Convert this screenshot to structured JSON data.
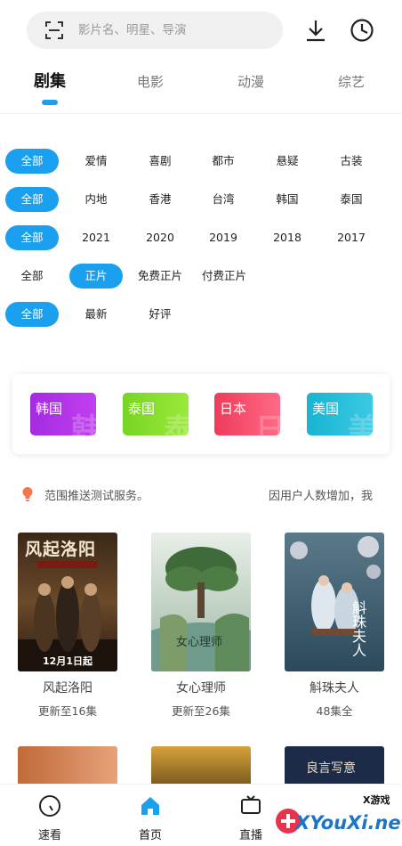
{
  "search": {
    "placeholder": "影片名、明星、导演"
  },
  "icons": {
    "scan": "scan-icon",
    "download": "download-icon",
    "history": "clock-icon",
    "bulb": "lightbulb-icon"
  },
  "tabs": [
    {
      "label": "剧集",
      "active": true
    },
    {
      "label": "电影",
      "active": false
    },
    {
      "label": "动漫",
      "active": false
    },
    {
      "label": "综艺",
      "active": false
    }
  ],
  "filters": {
    "genre": [
      "全部",
      "爱情",
      "喜剧",
      "都市",
      "悬疑",
      "古装"
    ],
    "region": [
      "全部",
      "内地",
      "香港",
      "台湾",
      "韩国",
      "泰国"
    ],
    "year": [
      "全部",
      "2021",
      "2020",
      "2019",
      "2018",
      "2017"
    ],
    "pay": [
      "全部",
      "正片",
      "免费正片",
      "付费正片"
    ],
    "sort": [
      "全部",
      "最新",
      "好评"
    ]
  },
  "regions": [
    {
      "label": "韩国",
      "mark": "韩",
      "color_from": "#a32be0",
      "color_to": "#c23ff1"
    },
    {
      "label": "泰国",
      "mark": "泰",
      "color_from": "#77d523",
      "color_to": "#9be93b"
    },
    {
      "label": "日本",
      "mark": "日",
      "color_from": "#ee3b5b",
      "color_to": "#ff6a86"
    },
    {
      "label": "美国",
      "mark": "美",
      "color_from": "#18b4d2",
      "color_to": "#3cc9e4"
    }
  ],
  "notice": {
    "left": "范围推送测试服务。",
    "right": "因用户人数增加，我"
  },
  "shows": [
    {
      "title": "风起洛阳",
      "status": "更新至16集",
      "poster_text": "风起洛阳",
      "badge": "12月1日起"
    },
    {
      "title": "女心理师",
      "status": "更新至26集",
      "poster_text": "女心理师",
      "badge": ""
    },
    {
      "title": "斛珠夫人",
      "status": "48集全",
      "poster_text": "斛珠夫人",
      "badge": ""
    }
  ],
  "more_posters": {
    "third_title": "良言写意"
  },
  "bottom_nav": [
    {
      "label": "速看",
      "icon": "compass-icon"
    },
    {
      "label": "首页",
      "icon": "home-icon",
      "active": true
    },
    {
      "label": "直播",
      "icon": "tv-icon"
    }
  ],
  "watermark": {
    "small": "X游戏",
    "big": "XYouXi.net"
  },
  "colors": {
    "accent": "#1aa0ee"
  }
}
